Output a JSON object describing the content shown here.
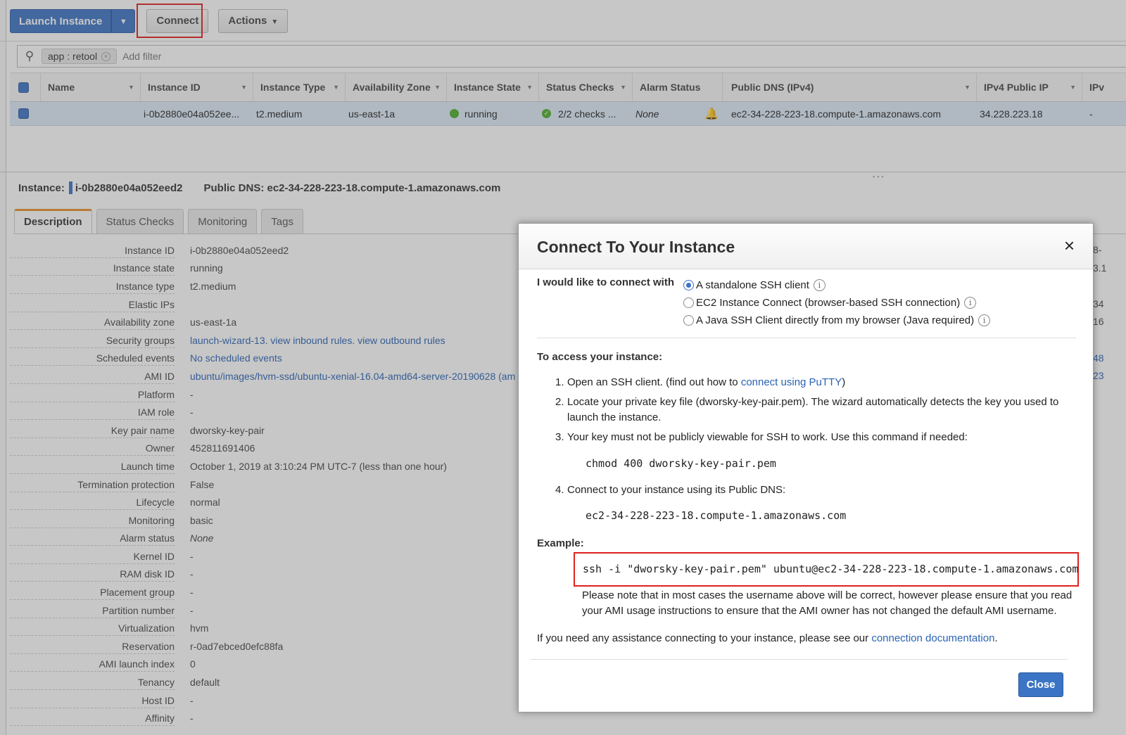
{
  "toolbar": {
    "launch_label": "Launch Instance",
    "connect_label": "Connect",
    "actions_label": "Actions"
  },
  "filter": {
    "chip": "app : retool",
    "placeholder": "Add filter"
  },
  "grid": {
    "headers": [
      "Name",
      "Instance ID",
      "Instance Type",
      "Availability Zone",
      "Instance State",
      "Status Checks",
      "Alarm Status",
      "Public DNS (IPv4)",
      "IPv4 Public IP",
      "IPv"
    ],
    "row": {
      "name": "",
      "instance_id": "i-0b2880e04a052ee...",
      "instance_type": "t2.medium",
      "az": "us-east-1a",
      "state": "running",
      "status_checks": "2/2 checks ...",
      "alarm": "None",
      "dns": "ec2-34-228-223-18.compute-1.amazonaws.com",
      "ip": "34.228.223.18",
      "ipv6": "-"
    }
  },
  "detail": {
    "instance_label": "Instance:",
    "instance_id": "i-0b2880e04a052eed2",
    "dns_label": "Public DNS:",
    "dns": "ec2-34-228-223-18.compute-1.amazonaws.com"
  },
  "tabs": [
    "Description",
    "Status Checks",
    "Monitoring",
    "Tags"
  ],
  "description": [
    {
      "label": "Instance ID",
      "value": "i-0b2880e04a052eed2"
    },
    {
      "label": "Instance state",
      "value": "running"
    },
    {
      "label": "Instance type",
      "value": "t2.medium"
    },
    {
      "label": "Elastic IPs",
      "value": ""
    },
    {
      "label": "Availability zone",
      "value": "us-east-1a"
    },
    {
      "label": "Security groups",
      "value": "launch-wizard-13. view inbound rules. view outbound rules"
    },
    {
      "label": "Scheduled events",
      "value": "No scheduled events"
    },
    {
      "label": "AMI ID",
      "value": "ubuntu/images/hvm-ssd/ubuntu-xenial-16.04-amd64-server-20190628 (am"
    },
    {
      "label": "Platform",
      "value": "-"
    },
    {
      "label": "IAM role",
      "value": "-"
    },
    {
      "label": "Key pair name",
      "value": "dworsky-key-pair"
    },
    {
      "label": "Owner",
      "value": "452811691406"
    },
    {
      "label": "Launch time",
      "value": "October 1, 2019 at 3:10:24 PM UTC-7 (less than one hour)"
    },
    {
      "label": "Termination protection",
      "value": "False"
    },
    {
      "label": "Lifecycle",
      "value": "normal"
    },
    {
      "label": "Monitoring",
      "value": "basic"
    },
    {
      "label": "Alarm status",
      "value": "None"
    },
    {
      "label": "Kernel ID",
      "value": "-"
    },
    {
      "label": "RAM disk ID",
      "value": "-"
    },
    {
      "label": "Placement group",
      "value": "-"
    },
    {
      "label": "Partition number",
      "value": "-"
    },
    {
      "label": "Virtualization",
      "value": "hvm"
    },
    {
      "label": "Reservation",
      "value": "r-0ad7ebced0efc88fa"
    },
    {
      "label": "AMI launch index",
      "value": "0"
    },
    {
      "label": "Tenancy",
      "value": "default"
    },
    {
      "label": "Host ID",
      "value": "-"
    },
    {
      "label": "Affinity",
      "value": "-"
    }
  ],
  "edge_values": [
    "8-",
    "3.1",
    "",
    "34",
    "16",
    "",
    "48",
    "23"
  ],
  "modal": {
    "title": "Connect To Your Instance",
    "close_icon": "×",
    "connect_with_label": "I would like to connect with",
    "options": [
      {
        "label": "A standalone SSH client",
        "selected": true
      },
      {
        "label": "EC2 Instance Connect (browser-based SSH connection)",
        "selected": false
      },
      {
        "label": "A Java SSH Client directly from my browser (Java required)",
        "selected": false
      }
    ],
    "access_heading": "To access your instance:",
    "step1_n": "1.",
    "step1_pre": "Open an SSH client. (find out how to ",
    "step1_link": "connect using PuTTY",
    "step1_post": ")",
    "step2_n": "2.",
    "step2": "Locate your private key file (dworsky-key-pair.pem). The wizard automatically detects the key you used to launch the instance.",
    "step3_n": "3.",
    "step3": "Your key must not be publicly viewable for SSH to work. Use this command if needed:",
    "chmod_cmd": "chmod 400 dworsky-key-pair.pem",
    "step4_n": "4.",
    "step4": "Connect to your instance using its Public DNS:",
    "dns_value": "ec2-34-228-223-18.compute-1.amazonaws.com",
    "example_heading": "Example:",
    "ssh_cmd": "ssh -i \"dworsky-key-pair.pem\" ubuntu@ec2-34-228-223-18.compute-1.amazonaws.com",
    "note": "Please note that in most cases the username above will be correct, however please ensure that you read your AMI usage instructions to ensure that the AMI owner has not changed the default AMI username.",
    "help_pre": "If you need any assistance connecting to your instance, please see our ",
    "help_link": "connection documentation",
    "help_post": ".",
    "close_button": "Close"
  },
  "colors": {
    "primary_blue": "#3b74c4",
    "highlight_red": "#e02020",
    "running_green": "#4cae2c",
    "tab_accent": "#e8912d"
  },
  "icons": {
    "search": "search-icon",
    "caret": "caret-down-icon",
    "info": "info-icon",
    "close": "close-icon",
    "alarm": "alarm-bell-icon"
  }
}
